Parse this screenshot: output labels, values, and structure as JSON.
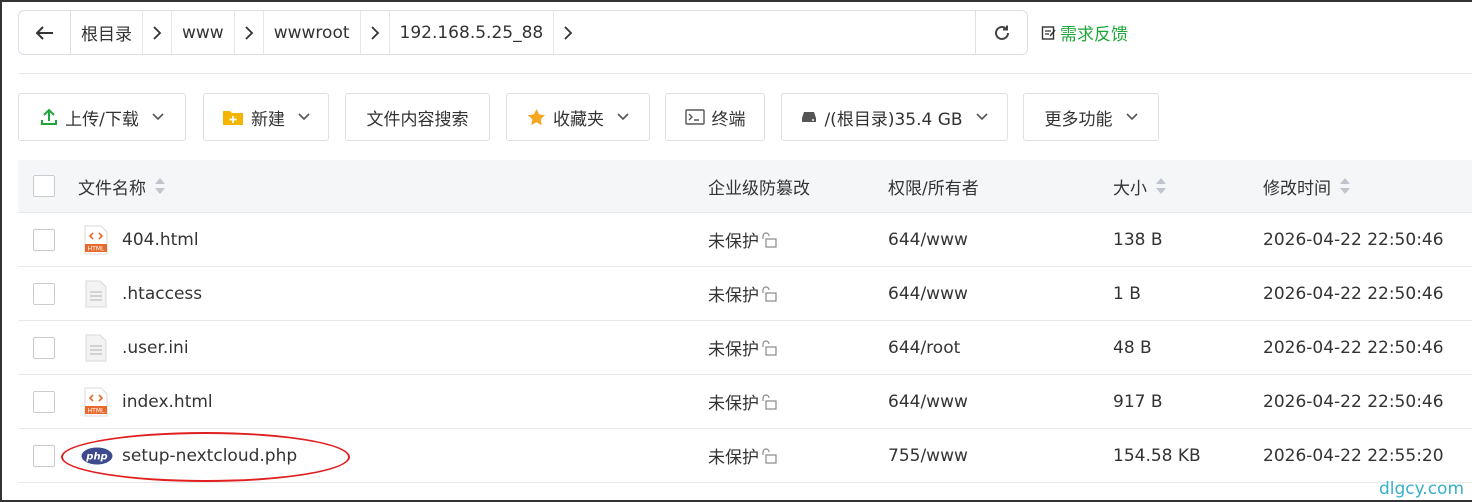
{
  "path": {
    "crumbs": [
      "根目录",
      "www",
      "wwwroot",
      "192.168.5.25_88"
    ]
  },
  "feedback_label": "需求反馈",
  "toolbar": {
    "upload": "上传/下载",
    "new": "新建",
    "search": "文件内容搜索",
    "favorites": "收藏夹",
    "terminal": "终端",
    "disk": "/(根目录)35.4 GB",
    "more": "更多功能"
  },
  "table": {
    "headers": {
      "name": "文件名称",
      "protect": "企业级防篡改",
      "perm": "权限/所有者",
      "size": "大小",
      "mtime": "修改时间"
    },
    "rows": [
      {
        "name": "404.html",
        "type": "html",
        "protect": "未保护",
        "perm": "644/www",
        "size": "138 B",
        "mtime": "2026-04-22 22:50:46"
      },
      {
        "name": ".htaccess",
        "type": "text",
        "protect": "未保护",
        "perm": "644/www",
        "size": "1 B",
        "mtime": "2026-04-22 22:50:46"
      },
      {
        "name": ".user.ini",
        "type": "text",
        "protect": "未保护",
        "perm": "644/root",
        "size": "48 B",
        "mtime": "2026-04-22 22:50:46"
      },
      {
        "name": "index.html",
        "type": "html",
        "protect": "未保护",
        "perm": "644/www",
        "size": "917 B",
        "mtime": "2026-04-22 22:50:46"
      },
      {
        "name": "setup-nextcloud.php",
        "type": "php",
        "protect": "未保护",
        "perm": "755/www",
        "size": "154.58 KB",
        "mtime": "2026-04-22 22:55:20"
      }
    ]
  },
  "icons": {
    "html_badge": "HTML",
    "php_badge": "php"
  },
  "watermark": "dlgcy.com",
  "colors": {
    "accent_green": "#20a53a",
    "annotation_red": "#e02020",
    "html_orange": "#e8692c",
    "php_navy": "#3d4a8e"
  }
}
